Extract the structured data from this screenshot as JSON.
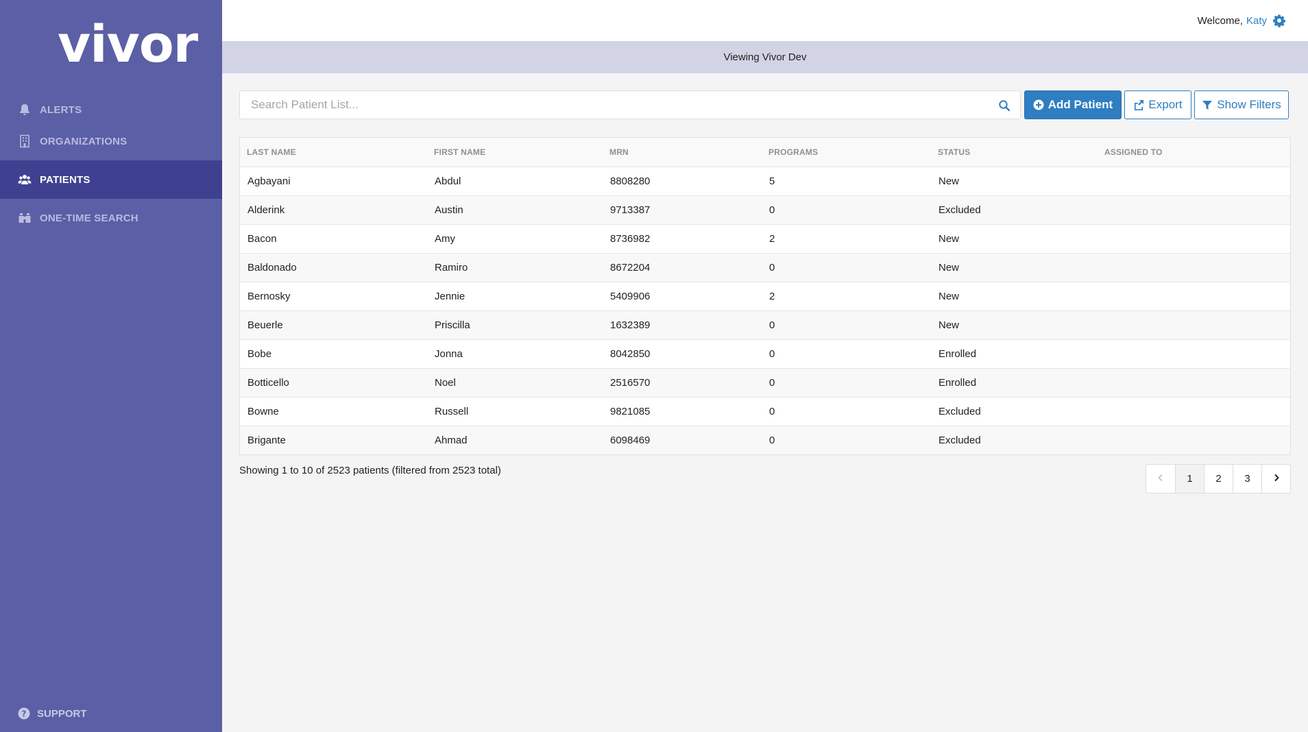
{
  "app": {
    "logo_text": "vivor"
  },
  "sidebar": {
    "items": [
      {
        "label": "ALERTS",
        "icon": "bell-icon"
      },
      {
        "label": "ORGANIZATIONS",
        "icon": "building-icon"
      },
      {
        "label": "PATIENTS",
        "icon": "users-icon",
        "active": true
      },
      {
        "label": "ONE-TIME SEARCH",
        "icon": "binoculars-icon"
      }
    ],
    "support_label": "SUPPORT"
  },
  "header": {
    "welcome_prefix": "Welcome,",
    "user_name": "Katy",
    "viewing_prefix": "Viewing",
    "viewing_org": "Vivor Dev"
  },
  "toolbar": {
    "search_placeholder": "Search Patient List...",
    "add_label": "Add Patient",
    "export_label": "Export",
    "filters_label": "Show Filters"
  },
  "table": {
    "columns": [
      "LAST NAME",
      "FIRST NAME",
      "MRN",
      "PROGRAMS",
      "STATUS",
      "ASSIGNED TO"
    ],
    "rows": [
      [
        "Agbayani",
        "Abdul",
        "8808280",
        "5",
        "New",
        ""
      ],
      [
        "Alderink",
        "Austin",
        "9713387",
        "0",
        "Excluded",
        ""
      ],
      [
        "Bacon",
        "Amy",
        "8736982",
        "2",
        "New",
        ""
      ],
      [
        "Baldonado",
        "Ramiro",
        "8672204",
        "0",
        "New",
        ""
      ],
      [
        "Bernosky",
        "Jennie",
        "5409906",
        "2",
        "New",
        ""
      ],
      [
        "Beuerle",
        "Priscilla",
        "1632389",
        "0",
        "New",
        ""
      ],
      [
        "Bobe",
        "Jonna",
        "8042850",
        "0",
        "Enrolled",
        ""
      ],
      [
        "Botticello",
        "Noel",
        "2516570",
        "0",
        "Enrolled",
        ""
      ],
      [
        "Bowne",
        "Russell",
        "9821085",
        "0",
        "Excluded",
        ""
      ],
      [
        "Brigante",
        "Ahmad",
        "6098469",
        "0",
        "Excluded",
        ""
      ]
    ]
  },
  "footer": {
    "showing_text": "Showing 1 to 10 of 2523 patients (filtered from 2523 total)"
  },
  "pagination": {
    "pages": [
      "1",
      "2",
      "3"
    ],
    "current": "1"
  },
  "colors": {
    "sidebar": "#5b5fa5",
    "sidebar_active": "#3f4190",
    "accent": "#2f7ec2",
    "view_bar": "#d2d3e5"
  }
}
